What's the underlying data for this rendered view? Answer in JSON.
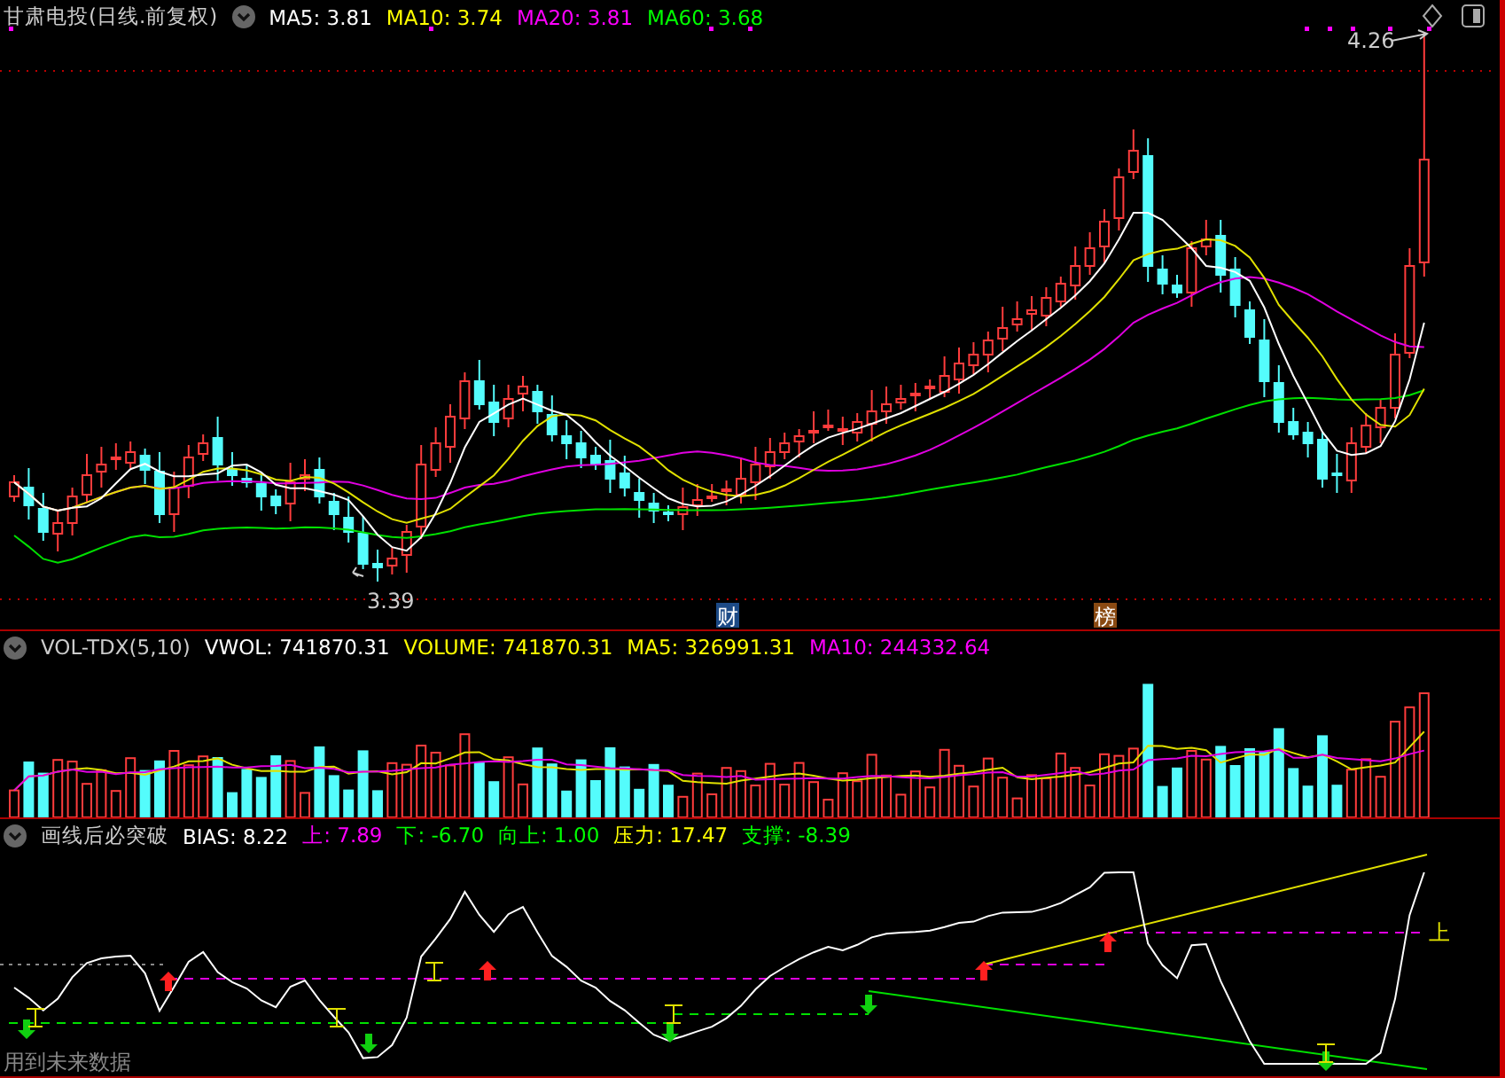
{
  "main": {
    "title": "甘肃电投(日线.前复权)",
    "legend": [
      {
        "text": "MA5: 3.81",
        "color": "#ffffff"
      },
      {
        "text": "MA10: 3.74",
        "color": "#ffff00"
      },
      {
        "text": "MA20: 3.81",
        "color": "#ff00ff"
      },
      {
        "text": "MA60: 3.68",
        "color": "#00ff00"
      }
    ],
    "high_label": "4.26",
    "low_label": "3.39",
    "badges": [
      {
        "text": "财",
        "color": "#1c4a86"
      },
      {
        "text": "榜",
        "color": "#8a4a12"
      }
    ]
  },
  "volume": {
    "title": "VOL-TDX(5,10)",
    "legend": [
      {
        "text": "VWOL: 741870.31",
        "color": "#ffffff"
      },
      {
        "text": "VOLUME: 741870.31",
        "color": "#ffff00"
      },
      {
        "text": "MA5: 326991.31",
        "color": "#ffff00"
      },
      {
        "text": "MA10: 244332.64",
        "color": "#ff00ff"
      }
    ]
  },
  "bias": {
    "title": "画线后必突破",
    "legend": [
      {
        "text": "BIAS: 8.22",
        "color": "#ffffff"
      },
      {
        "text": "上: 7.89",
        "color": "#ff00ff"
      },
      {
        "text": "下: -6.70",
        "color": "#00ff00"
      },
      {
        "text": "向上: 1.00",
        "color": "#00ff00"
      },
      {
        "text": "压力: 17.47",
        "color": "#ffff00"
      },
      {
        "text": "支撑: -8.39",
        "color": "#00ff00"
      }
    ],
    "end_label": "上",
    "note": "用到未来数据"
  }
}
